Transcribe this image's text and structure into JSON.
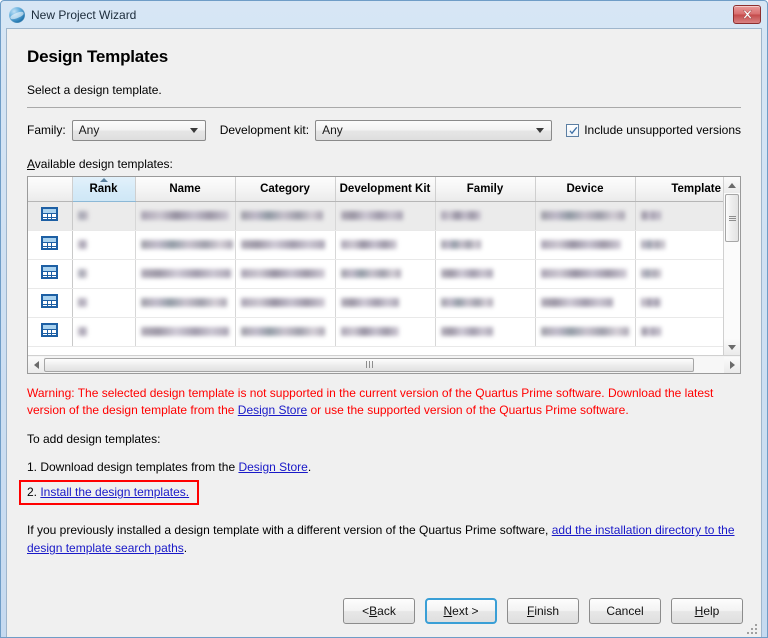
{
  "window": {
    "title": "New Project Wizard",
    "icon": "globe-icon",
    "close_label": "X"
  },
  "page": {
    "title": "Design Templates",
    "subtitle": "Select a design template."
  },
  "filters": {
    "family_label": "Family:",
    "family_value": "Any",
    "kit_label": "Development kit:",
    "kit_value": "Any",
    "include_unsupported_label": "Include unsupported versions",
    "include_unsupported_checked": true
  },
  "table": {
    "label": "Available design templates:",
    "label_mnemonic": "A",
    "sorted_column": "Rank",
    "sort_direction": "ascending",
    "columns": [
      {
        "key": "icon",
        "label": ""
      },
      {
        "key": "rank",
        "label": "Rank"
      },
      {
        "key": "name",
        "label": "Name"
      },
      {
        "key": "category",
        "label": "Category"
      },
      {
        "key": "devkit",
        "label": "Development Kit"
      },
      {
        "key": "family",
        "label": "Family"
      },
      {
        "key": "device",
        "label": "Device"
      },
      {
        "key": "version",
        "label": "Template Versi"
      }
    ],
    "rows": [
      {
        "selected": true,
        "icon": "grid-icon",
        "rank": "",
        "name": "",
        "category": "",
        "devkit": "",
        "family": "",
        "device": "",
        "version": ""
      },
      {
        "selected": false,
        "icon": "grid-icon",
        "rank": "",
        "name": "",
        "category": "",
        "devkit": "",
        "family": "",
        "device": "",
        "version": ""
      },
      {
        "selected": false,
        "icon": "grid-icon",
        "rank": "",
        "name": "",
        "category": "",
        "devkit": "",
        "family": "",
        "device": "",
        "version": ""
      },
      {
        "selected": false,
        "icon": "grid-icon",
        "rank": "",
        "name": "",
        "category": "",
        "devkit": "",
        "family": "",
        "device": "",
        "version": ""
      },
      {
        "selected": false,
        "icon": "grid-icon",
        "rank": "",
        "name": "",
        "category": "",
        "devkit": "",
        "family": "",
        "device": "",
        "version": ""
      }
    ]
  },
  "warning": {
    "part1": "Warning: The selected design template is not supported in the current version of the Quartus Prime software. Download the latest version of the design template from the ",
    "link": "Design Store",
    "part2": " or use the supported version of the Quartus Prime software.",
    "color": "#ff0000"
  },
  "instructions": {
    "heading": "To add design templates:",
    "step1_prefix": "1. Download design templates from the ",
    "step1_link": "Design Store",
    "step1_suffix": ".",
    "step2_prefix": "2. ",
    "step2_link": "Install the design templates.",
    "step2_highlight_color": "#ff0000"
  },
  "footer_note": {
    "part1": "If you previously installed a design template with a different version of the Quartus Prime software, ",
    "link": "add the installation directory to the design template search paths",
    "part2": "."
  },
  "buttons": {
    "back": "< Back",
    "back_mnemonic": "B",
    "next": "Next >",
    "next_mnemonic": "N",
    "next_focused": true,
    "finish": "Finish",
    "finish_mnemonic": "F",
    "cancel": "Cancel",
    "help": "Help",
    "help_mnemonic": "H"
  },
  "colors": {
    "link": "#1919c8",
    "warning": "#ff0000",
    "highlight": "#ff0000",
    "focus": "#3a9fd6",
    "sorted_header": "#d6ebf8"
  }
}
